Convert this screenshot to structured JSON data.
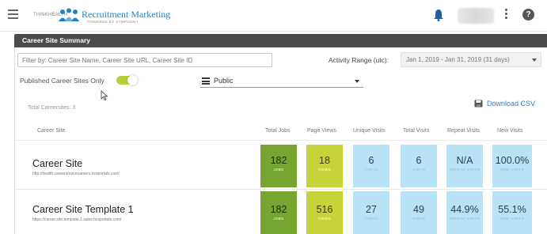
{
  "header": {
    "brand_small": "THINKHEALTH",
    "brand_name": "Recruitment Marketing",
    "brand_sub": "POWERED BY SYMPHONY"
  },
  "panel": {
    "title": "Career Site Summary"
  },
  "filters": {
    "search_placeholder": "Filter by: Career Site Name, Career Site URL, Career Site ID",
    "range_label": "Activity Range (utc):",
    "range_value": "Jan 1, 2019 - Jan 31, 2019 (31 days)",
    "published_label": "Published Career Sites Only",
    "published_on": true,
    "visibility_value": "Public"
  },
  "summary": {
    "total_label": "Total Careersites: 3",
    "download_label": "Download CSV"
  },
  "table": {
    "columns": [
      "Career Site",
      "Total Jobs",
      "Page Views",
      "Unique Visits",
      "Total Visits",
      "Repeat Visits",
      "New Visits"
    ],
    "rows": [
      {
        "name": "Career Site",
        "url": "http://health.careersourcecareers.hcsportals.com/",
        "total_jobs": "182",
        "total_jobs_sub": "JOBS",
        "page_views": "18",
        "page_views_sub": "VIEWS",
        "unique_visits": "6",
        "unique_visits_sub": "VISITS",
        "total_visits": "6",
        "total_visits_sub": "VISITS",
        "repeat_visits": "N/A",
        "repeat_visits_sub": "REPEAT VISITS",
        "new_visits": "100.0%",
        "new_visits_sub": "NEW VISITS"
      },
      {
        "name": "Career Site Template 1",
        "url": "https://career.site.template.1.sales.hcsportals.com/",
        "total_jobs": "182",
        "total_jobs_sub": "JOBS",
        "page_views": "516",
        "page_views_sub": "VIEWS",
        "unique_visits": "27",
        "unique_visits_sub": "VISITS",
        "total_visits": "49",
        "total_visits_sub": "VISITS",
        "repeat_visits": "44.9%",
        "repeat_visits_sub": "REPEAT VISITS",
        "new_visits": "55.1%",
        "new_visits_sub": "NEW VISITS"
      }
    ]
  },
  "colors": {
    "jobs_tile": "#76a631",
    "views_tile": "#c6d43a",
    "visits_tile": "#b8e3f6",
    "accent": "#2f7fc1",
    "header_bar": "#4b4b4b"
  }
}
